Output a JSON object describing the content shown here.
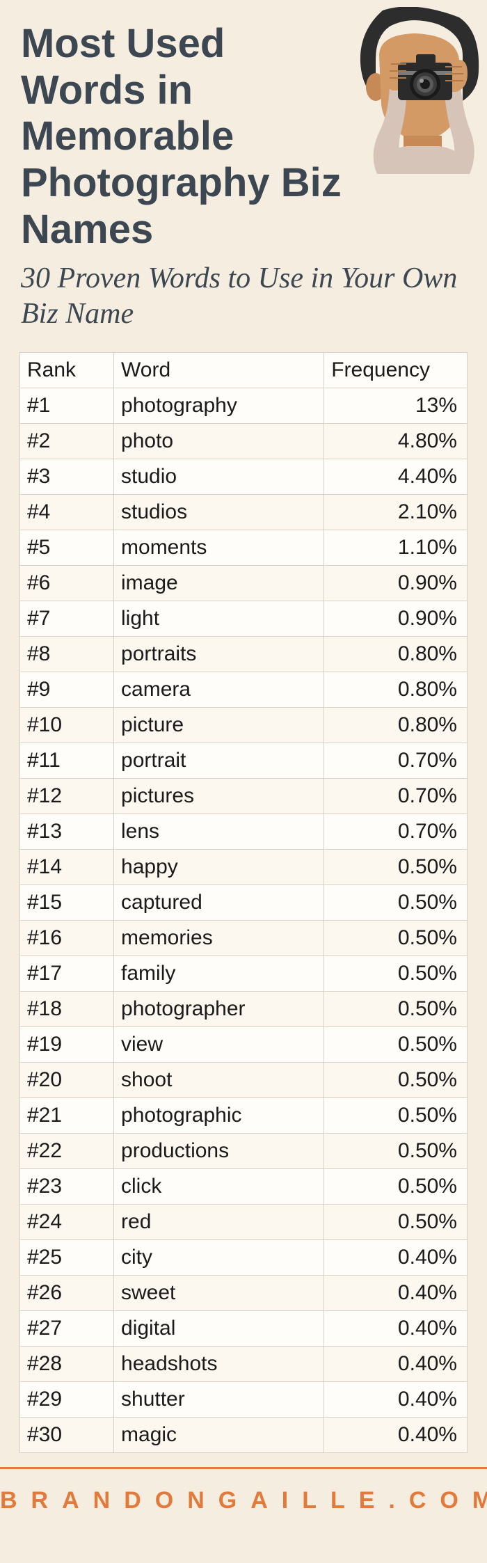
{
  "header": {
    "title": "Most Used Words in Memorable Photography Biz Names",
    "subtitle": "30 Proven Words to Use in Your Own Biz Name"
  },
  "table": {
    "headers": {
      "rank": "Rank",
      "word": "Word",
      "frequency": "Frequency"
    },
    "rows": [
      {
        "rank": "#1",
        "word": "photography",
        "frequency": "13%"
      },
      {
        "rank": "#2",
        "word": "photo",
        "frequency": "4.80%"
      },
      {
        "rank": "#3",
        "word": "studio",
        "frequency": "4.40%"
      },
      {
        "rank": "#4",
        "word": "studios",
        "frequency": "2.10%"
      },
      {
        "rank": "#5",
        "word": "moments",
        "frequency": "1.10%"
      },
      {
        "rank": "#6",
        "word": "image",
        "frequency": "0.90%"
      },
      {
        "rank": "#7",
        "word": "light",
        "frequency": "0.90%"
      },
      {
        "rank": "#8",
        "word": "portraits",
        "frequency": "0.80%"
      },
      {
        "rank": "#9",
        "word": "camera",
        "frequency": "0.80%"
      },
      {
        "rank": "#10",
        "word": "picture",
        "frequency": "0.80%"
      },
      {
        "rank": "#11",
        "word": "portrait",
        "frequency": "0.70%"
      },
      {
        "rank": "#12",
        "word": "pictures",
        "frequency": "0.70%"
      },
      {
        "rank": "#13",
        "word": "lens",
        "frequency": "0.70%"
      },
      {
        "rank": "#14",
        "word": "happy",
        "frequency": "0.50%"
      },
      {
        "rank": "#15",
        "word": "captured",
        "frequency": "0.50%"
      },
      {
        "rank": "#16",
        "word": "memories",
        "frequency": "0.50%"
      },
      {
        "rank": "#17",
        "word": "family",
        "frequency": "0.50%"
      },
      {
        "rank": "#18",
        "word": "photographer",
        "frequency": "0.50%"
      },
      {
        "rank": "#19",
        "word": "view",
        "frequency": "0.50%"
      },
      {
        "rank": "#20",
        "word": "shoot",
        "frequency": "0.50%"
      },
      {
        "rank": "#21",
        "word": "photographic",
        "frequency": "0.50%"
      },
      {
        "rank": "#22",
        "word": "productions",
        "frequency": "0.50%"
      },
      {
        "rank": "#23",
        "word": "click",
        "frequency": "0.50%"
      },
      {
        "rank": "#24",
        "word": "red",
        "frequency": "0.50%"
      },
      {
        "rank": "#25",
        "word": "city",
        "frequency": "0.40%"
      },
      {
        "rank": "#26",
        "word": "sweet",
        "frequency": "0.40%"
      },
      {
        "rank": "#27",
        "word": "digital",
        "frequency": "0.40%"
      },
      {
        "rank": "#28",
        "word": "headshots",
        "frequency": "0.40%"
      },
      {
        "rank": "#29",
        "word": "shutter",
        "frequency": "0.40%"
      },
      {
        "rank": "#30",
        "word": "magic",
        "frequency": "0.40%"
      }
    ]
  },
  "footer": {
    "text": "BRANDONGAILLE.COM"
  },
  "chart_data": {
    "type": "table",
    "title": "Most Used Words in Memorable Photography Biz Names",
    "columns": [
      "Rank",
      "Word",
      "Frequency"
    ],
    "rows": [
      [
        1,
        "photography",
        13.0
      ],
      [
        2,
        "photo",
        4.8
      ],
      [
        3,
        "studio",
        4.4
      ],
      [
        4,
        "studios",
        2.1
      ],
      [
        5,
        "moments",
        1.1
      ],
      [
        6,
        "image",
        0.9
      ],
      [
        7,
        "light",
        0.9
      ],
      [
        8,
        "portraits",
        0.8
      ],
      [
        9,
        "camera",
        0.8
      ],
      [
        10,
        "picture",
        0.8
      ],
      [
        11,
        "portrait",
        0.7
      ],
      [
        12,
        "pictures",
        0.7
      ],
      [
        13,
        "lens",
        0.7
      ],
      [
        14,
        "happy",
        0.5
      ],
      [
        15,
        "captured",
        0.5
      ],
      [
        16,
        "memories",
        0.5
      ],
      [
        17,
        "family",
        0.5
      ],
      [
        18,
        "photographer",
        0.5
      ],
      [
        19,
        "view",
        0.5
      ],
      [
        20,
        "shoot",
        0.5
      ],
      [
        21,
        "photographic",
        0.5
      ],
      [
        22,
        "productions",
        0.5
      ],
      [
        23,
        "click",
        0.5
      ],
      [
        24,
        "red",
        0.5
      ],
      [
        25,
        "city",
        0.4
      ],
      [
        26,
        "sweet",
        0.4
      ],
      [
        27,
        "digital",
        0.4
      ],
      [
        28,
        "headshots",
        0.4
      ],
      [
        29,
        "shutter",
        0.4
      ],
      [
        30,
        "magic",
        0.4
      ]
    ]
  }
}
